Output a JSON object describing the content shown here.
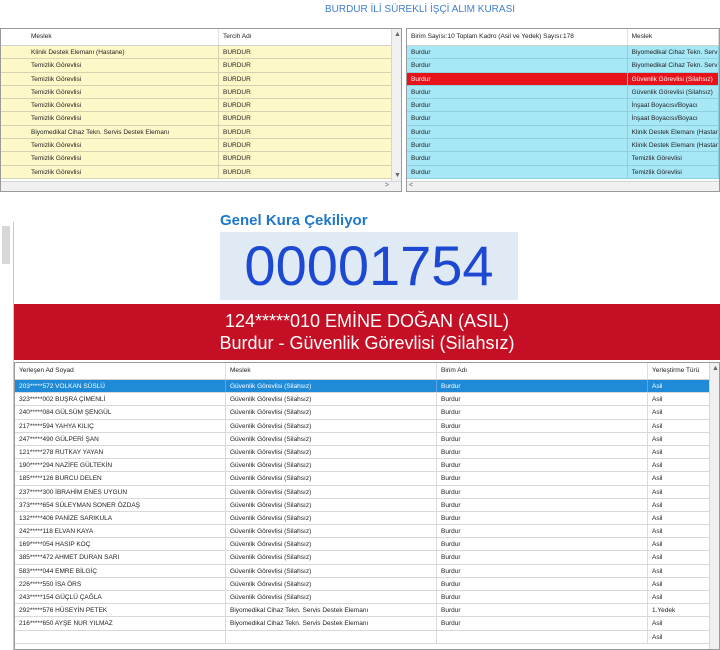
{
  "app": {
    "title": "BURDUR İLİ SÜREKLİ İŞÇİ ALIM KURASI"
  },
  "left_grid": {
    "columns": [
      "Meslek",
      "Tercih Adı"
    ],
    "rows": [
      [
        "Klinik Destek Elemanı (Hastane)",
        "BURDUR"
      ],
      [
        "Temizlik Görevlisi",
        "BURDUR"
      ],
      [
        "Temizlik Görevlisi",
        "BURDUR"
      ],
      [
        "Temizlik Görevlisi",
        "BURDUR"
      ],
      [
        "Temizlik Görevlisi",
        "BURDUR"
      ],
      [
        "Temizlik Görevlisi",
        "BURDUR"
      ],
      [
        "Biyomedikal Cihaz Tekn. Servis Destek Elemanı",
        "BURDUR"
      ],
      [
        "Temizlik Görevlisi",
        "BURDUR"
      ],
      [
        "Temizlik Görevlisi",
        "BURDUR"
      ],
      [
        "Temizlik Görevlisi",
        "BURDUR"
      ]
    ]
  },
  "right_grid": {
    "columns": [
      "Birim Sayısı:10 Toplam Kadro (Asil ve Yedek) Sayısı:178",
      "Meslek"
    ],
    "selected_index": 2,
    "rows": [
      [
        "Burdur",
        "Biyomedikal Cihaz Tekn. Serv"
      ],
      [
        "Burdur",
        "Biyomedikal Cihaz Tekn. Serv"
      ],
      [
        "Burdur",
        "Güvenlik Görevlisi (Silahsız)"
      ],
      [
        "Burdur",
        "Güvenlik Görevlisi (Silahsız)"
      ],
      [
        "Burdur",
        "İnşaat Boyacısı/Boyacı"
      ],
      [
        "Burdur",
        "İnşaat Boyacısı/Boyacı"
      ],
      [
        "Burdur",
        "Klinik Destek Elemanı (Hastan"
      ],
      [
        "Burdur",
        "Klinik Destek Elemanı (Hastan"
      ],
      [
        "Burdur",
        "Temizlik Görevlisi"
      ],
      [
        "Burdur",
        "Temizlik Görevlisi"
      ]
    ]
  },
  "draw": {
    "heading": "Genel Kura Çekiliyor",
    "number": "00001754",
    "result_line1": "124*****010 EMİNE DOĞAN (ASIL)",
    "result_line2": "Burdur - Güvenlik Görevlisi (Silahsız)"
  },
  "results_grid": {
    "columns": [
      "Yerleşen Ad Soyad",
      "Meslek",
      "Birim Adı",
      "Yerleştirme Türü"
    ],
    "selected_index": 0,
    "rows": [
      [
        "203*****572 VOLKAN SÜSLÜ",
        "Güvenlik Görevlisi (Silahsız)",
        "Burdur",
        "Asil"
      ],
      [
        "323*****002 BUŞRA ÇİMENLİ",
        "Güvenlik Görevlisi (Silahsız)",
        "Burdur",
        "Asil"
      ],
      [
        "240*****084 GÜLSÜM ŞENGÜL",
        "Güvenlik Görevlisi (Silahsız)",
        "Burdur",
        "Asil"
      ],
      [
        "217*****594 YAHYA KILIÇ",
        "Güvenlik Görevlisi (Silahsız)",
        "Burdur",
        "Asil"
      ],
      [
        "247*****490 GÜLPERİ ŞAN",
        "Güvenlik Görevlisi (Silahsız)",
        "Burdur",
        "Asil"
      ],
      [
        "121*****278 RUTKAY YAYAN",
        "Güvenlik Görevlisi (Silahsız)",
        "Burdur",
        "Asil"
      ],
      [
        "190*****294 NAZİFE GÜLTEKİN",
        "Güvenlik Görevlisi (Silahsız)",
        "Burdur",
        "Asil"
      ],
      [
        "185*****126 BURCU DELEN",
        "Güvenlik Görevlisi (Silahsız)",
        "Burdur",
        "Asil"
      ],
      [
        "237*****300 İBRAHİM ENES UYGUN",
        "Güvenlik Görevlisi (Silahsız)",
        "Burdur",
        "Asil"
      ],
      [
        "373*****654 SÜLEYMAN SONER ÖZDAŞ",
        "Güvenlik Görevlisi (Silahsız)",
        "Burdur",
        "Asil"
      ],
      [
        "132*****406 PANİZE SARIKULA",
        "Güvenlik Görevlisi (Silahsız)",
        "Burdur",
        "Asil"
      ],
      [
        "242*****118 ELVAN KAYA",
        "Güvenlik Görevlisi (Silahsız)",
        "Burdur",
        "Asil"
      ],
      [
        "169*****054 HASIP KOÇ",
        "Güvenlik Görevlisi (Silahsız)",
        "Burdur",
        "Asil"
      ],
      [
        "385*****472 AHMET DURAN SARI",
        "Güvenlik Görevlisi (Silahsız)",
        "Burdur",
        "Asil"
      ],
      [
        "583*****044 EMRE BİLGİÇ",
        "Güvenlik Görevlisi (Silahsız)",
        "Burdur",
        "Asil"
      ],
      [
        "226*****550 İSA ÖRS",
        "Güvenlik Görevlisi (Silahsız)",
        "Burdur",
        "Asil"
      ],
      [
        "243*****154 GÜÇLÜ ÇAĞLA",
        "Güvenlik Görevlisi (Silahsız)",
        "Burdur",
        "Asil"
      ],
      [
        "292*****576 HÜSEYİN PETEK",
        "Biyomedikal Cihaz Tekn. Servis Destek Elemanı",
        "Burdur",
        "1.Yedek"
      ],
      [
        "216*****650 AYŞE NUR YILMAZ",
        "Biyomedikal Cihaz Tekn. Servis Destek Elemanı",
        "Burdur",
        "Asil"
      ],
      [
        "",
        "",
        "",
        "Asil"
      ]
    ]
  },
  "colors": {
    "title": "#3f7fd0",
    "left_row_bg": "#fdf8c8",
    "right_row_bg": "#a7e8f7",
    "right_selected_bg": "#e8121a",
    "heading": "#1f78c8",
    "number": "#1d48d1",
    "banner_bg": "#c50f24",
    "results_selected_bg": "#1f8bd8"
  }
}
